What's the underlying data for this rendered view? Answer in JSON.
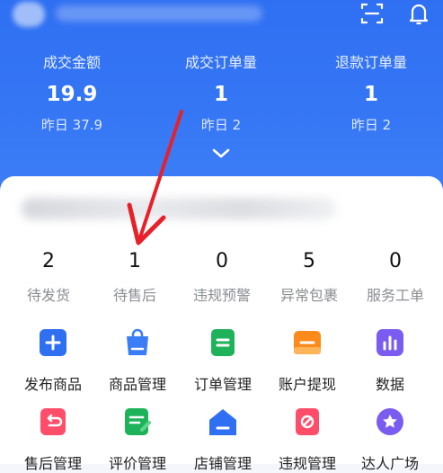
{
  "header": {
    "stats": [
      {
        "label": "成交金额",
        "value": "19.9",
        "yesterday": "昨日 37.9"
      },
      {
        "label": "成交订单量",
        "value": "1",
        "yesterday": "昨日 2"
      },
      {
        "label": "退款订单量",
        "value": "1",
        "yesterday": "昨日 2"
      }
    ]
  },
  "orders": [
    {
      "count": "2",
      "label": "待发货"
    },
    {
      "count": "1",
      "label": "待售后"
    },
    {
      "count": "0",
      "label": "违规预警"
    },
    {
      "count": "5",
      "label": "异常包裹"
    },
    {
      "count": "0",
      "label": "服务工单"
    }
  ],
  "tools_row1": [
    {
      "label": "发布商品",
      "icon": "plus-icon",
      "color": "#2f6ff2"
    },
    {
      "label": "商品管理",
      "icon": "shopping-bag-icon",
      "color": "#3a7df6"
    },
    {
      "label": "订单管理",
      "icon": "order-list-icon",
      "color": "#1eb35a"
    },
    {
      "label": "账户提现",
      "icon": "wallet-icon",
      "color": "#ff8a1c"
    },
    {
      "label": "数据",
      "icon": "bar-chart-icon",
      "color": "#7a5cf0"
    }
  ],
  "tools_row2": [
    {
      "label": "售后管理",
      "icon": "return-icon",
      "color": "#ff4d6a"
    },
    {
      "label": "评价管理",
      "icon": "review-icon",
      "color": "#1eb35a"
    },
    {
      "label": "店铺管理",
      "icon": "store-icon",
      "color": "#2f6ff2"
    },
    {
      "label": "违规管理",
      "icon": "violation-icon",
      "color": "#ff4d6a"
    },
    {
      "label": "达人广场",
      "icon": "star-badge-icon",
      "color": "#7a5cf0"
    }
  ]
}
